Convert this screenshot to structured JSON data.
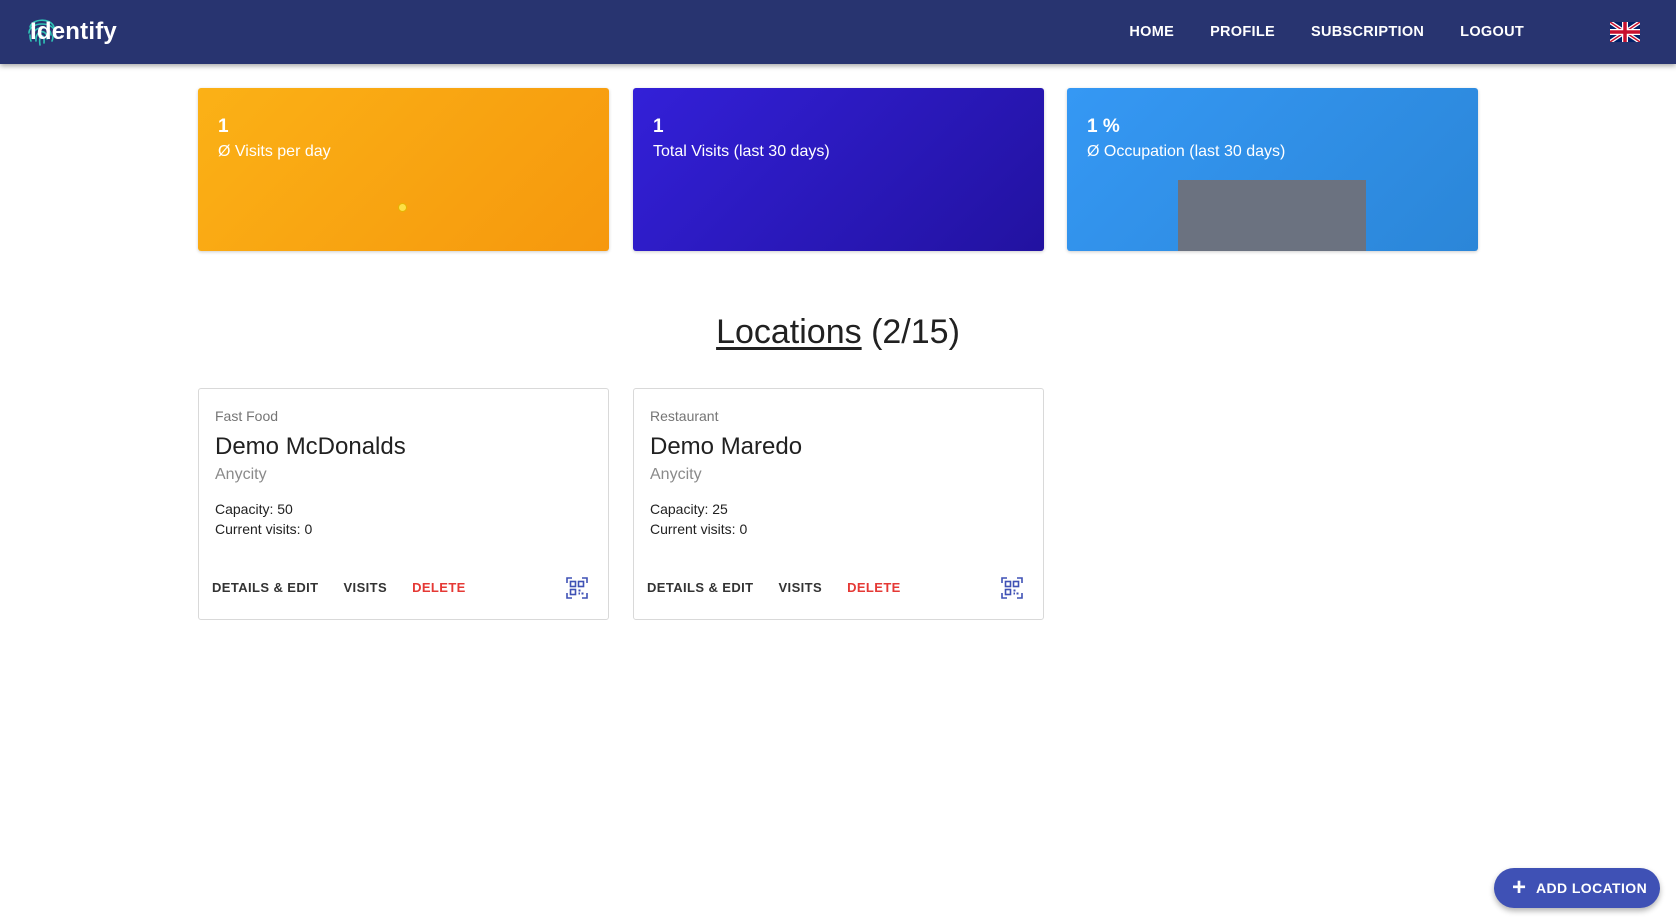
{
  "header": {
    "logo_text": "Identify",
    "nav": [
      "HOME",
      "PROFILE",
      "SUBSCRIPTION",
      "LOGOUT"
    ],
    "language_icon": "uk-flag-icon"
  },
  "stats": [
    {
      "value": "1",
      "label": "Ø Visits per day",
      "color": "#f8a810"
    },
    {
      "value": "1",
      "label": "Total Visits (last 30 days)",
      "color": "#2a18c0"
    },
    {
      "value": "1 %",
      "label": "Ø Occupation (last 30 days)",
      "color": "#3190e8"
    }
  ],
  "locations_section": {
    "title": "Locations",
    "count": "(2/15)"
  },
  "locations": [
    {
      "category": "Fast Food",
      "name": "Demo McDonalds",
      "city": "Anycity",
      "capacity": "Capacity: 50",
      "current_visits": "Current visits: 0",
      "actions": {
        "details": "DETAILS & EDIT",
        "visits": "VISITS",
        "delete": "DELETE"
      }
    },
    {
      "category": "Restaurant",
      "name": "Demo Maredo",
      "city": "Anycity",
      "capacity": "Capacity: 25",
      "current_visits": "Current visits: 0",
      "actions": {
        "details": "DETAILS & EDIT",
        "visits": "VISITS",
        "delete": "DELETE"
      }
    }
  ],
  "fab": {
    "icon": "plus-icon",
    "label": "ADD LOCATION",
    "color": "#3f51b5"
  },
  "colors": {
    "header_bg": "#283470",
    "delete": "#e53935",
    "qr_icon": "#3f51b5"
  }
}
